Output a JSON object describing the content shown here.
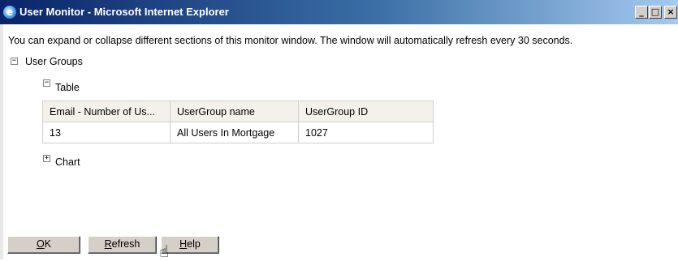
{
  "window": {
    "title": "User Monitor - Microsoft Internet Explorer",
    "minimize": "_",
    "maximize": "□",
    "close": "×"
  },
  "intro_text": "You can expand or collapse different sections of this monitor window. The window will automatically refresh every 30 seconds.",
  "sections": {
    "user_groups": {
      "label": "User Groups",
      "toggle": "−"
    },
    "table": {
      "label": "Table",
      "toggle": "−"
    },
    "chart": {
      "label": "Chart",
      "toggle": "+"
    }
  },
  "grid": {
    "headers": [
      "Email - Number of Us...",
      "UserGroup name",
      "UserGroup ID"
    ],
    "rows": [
      [
        "13",
        "All Users In Mortgage",
        "1027"
      ]
    ]
  },
  "buttons": {
    "ok": {
      "mnemonic": "O",
      "rest": "K"
    },
    "refresh": {
      "mnemonic": "R",
      "rest": "efresh"
    },
    "help": {
      "mnemonic": "H",
      "rest": "elp"
    }
  },
  "icons": {
    "app": "internet-explorer-icon",
    "cursor": "hand-pointer-icon"
  }
}
